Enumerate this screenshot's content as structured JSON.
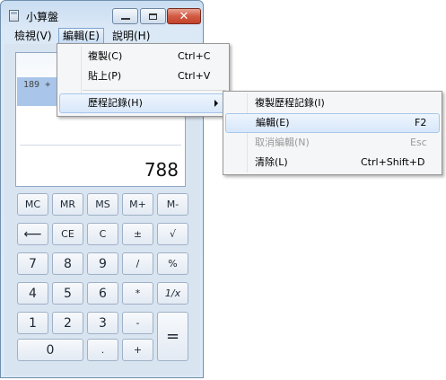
{
  "window": {
    "title": "小算盤"
  },
  "menubar": {
    "view": "檢視(V)",
    "edit": "編輯(E)",
    "help": "說明(H)"
  },
  "display": {
    "history": "189 +",
    "result": "788"
  },
  "keypad": {
    "rows": [
      [
        "MC",
        "MR",
        "MS",
        "M+",
        "M-"
      ],
      [
        "⟵",
        "CE",
        "C",
        "±",
        "√"
      ],
      [
        "7",
        "8",
        "9",
        "/",
        "%"
      ],
      [
        "4",
        "5",
        "6",
        "*",
        "1/x"
      ],
      [
        "1",
        "2",
        "3",
        "-"
      ],
      [
        "0",
        ".",
        "+"
      ]
    ],
    "equals": "="
  },
  "edit_menu": {
    "items": [
      {
        "label": "複製(C)",
        "accel": "Ctrl+C"
      },
      {
        "label": "貼上(P)",
        "accel": "Ctrl+V"
      },
      {
        "label": "歷程記錄(H)"
      }
    ]
  },
  "history_menu": {
    "items": [
      {
        "label": "複製歷程記錄(I)",
        "accel": ""
      },
      {
        "label": "編輯(E)",
        "accel": "F2"
      },
      {
        "label": "取消編輯(N)",
        "accel": "Esc"
      },
      {
        "label": "清除(L)",
        "accel": "Ctrl+Shift+D"
      }
    ]
  }
}
